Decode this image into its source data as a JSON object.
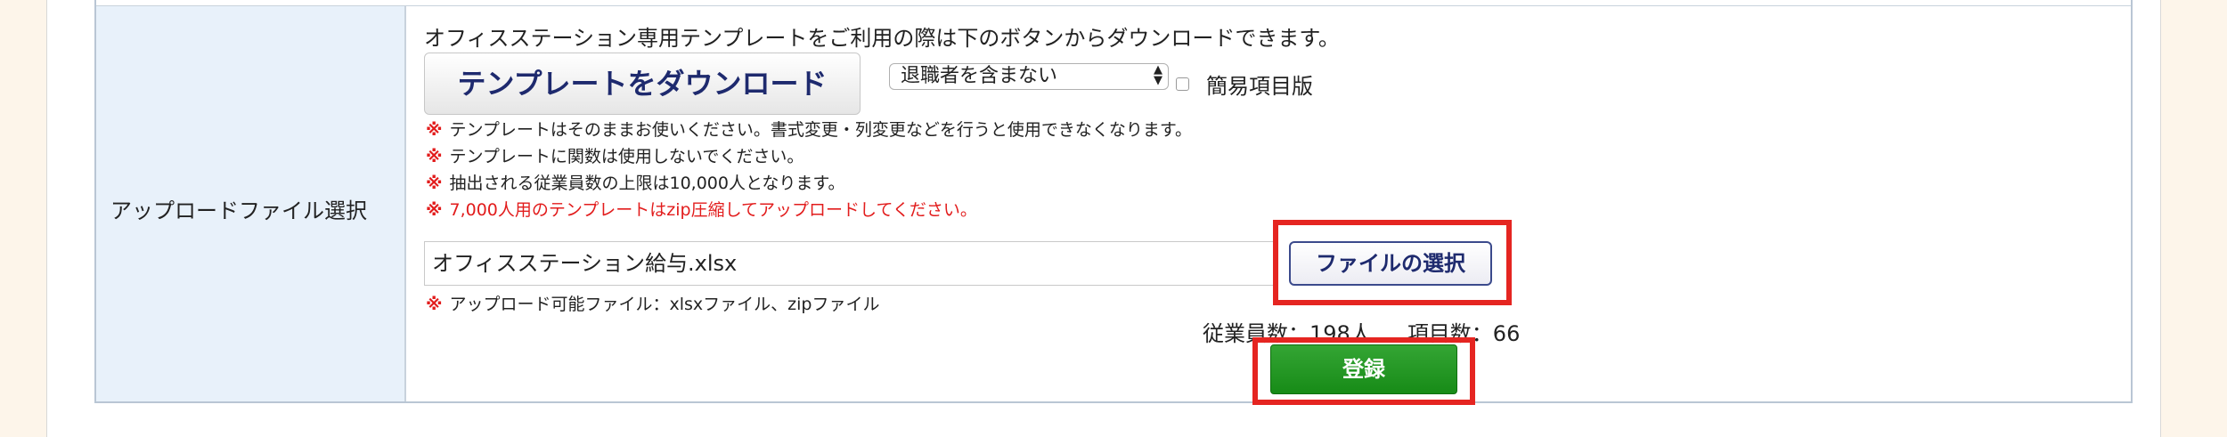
{
  "row_label": "アップロードファイル選択",
  "intro_text": "オフィスステーション専用テンプレートをご利用の際は下のボタンからダウンロードできます。",
  "template_button": "テンプレートをダウンロード",
  "select": {
    "value": "退職者を含まない"
  },
  "checkbox": {
    "label": "簡易項目版",
    "checked": false
  },
  "notes": [
    {
      "mark": "※",
      "text": "テンプレートはそのままお使いください。書式変更・列変更などを行うと使用できなくなります。"
    },
    {
      "mark": "※",
      "text": "テンプレートに関数は使用しないでください。"
    },
    {
      "mark": "※",
      "text": "抽出される従業員数の上限は10,000人となります。"
    },
    {
      "mark": "※",
      "text": "7,000人用のテンプレートはzip圧縮してアップロードしてください。"
    }
  ],
  "file": {
    "name": "オフィスステーション給与.xlsx",
    "choose_button": "ファイルの選択",
    "note_mark": "※",
    "note": "アップロード可能ファイル：xlsxファイル、zipファイル"
  },
  "stats": {
    "employees": "従業員数：198人",
    "items": "項目数：66"
  },
  "submit_button": "登録",
  "colors": {
    "highlight": "#e52521",
    "submit": "#178b17",
    "label_bg": "#e8f1fa",
    "warning": "#e21c1c"
  }
}
